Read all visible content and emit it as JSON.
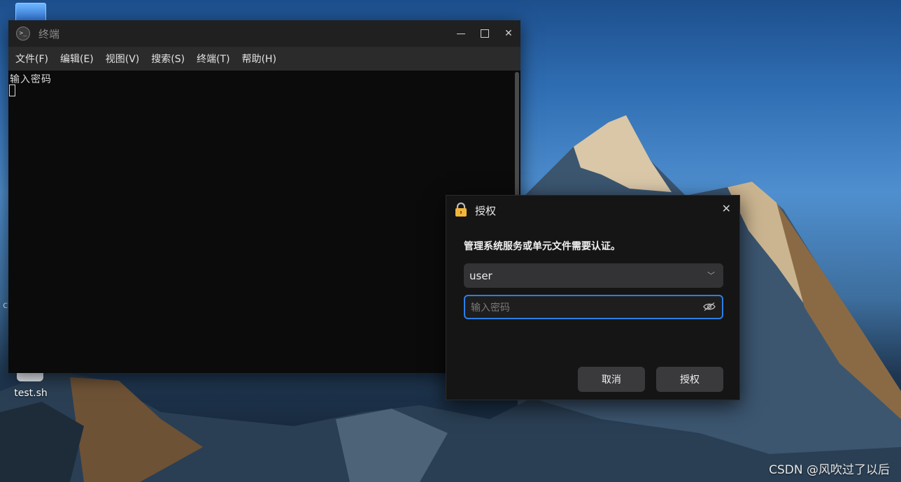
{
  "terminal": {
    "title": "终端",
    "menu": [
      "文件(F)",
      "编辑(E)",
      "视图(V)",
      "搜索(S)",
      "终端(T)",
      "帮助(H)"
    ],
    "output_line": "输入密码"
  },
  "desktop": {
    "file_label": "test.sh",
    "partial_label": "c"
  },
  "auth_dialog": {
    "title": "授权",
    "message": "管理系统服务或单元文件需要认证。",
    "user_value": "user",
    "password_placeholder": "输入密码",
    "cancel_label": "取消",
    "authorize_label": "授权",
    "icons": {
      "lock": "lock-icon",
      "close": "close-icon",
      "eye": "eye-icon",
      "chevron": "chevron-down-icon"
    },
    "accent_color": "#2d7ee6"
  },
  "watermark": "CSDN @风吹过了以后"
}
